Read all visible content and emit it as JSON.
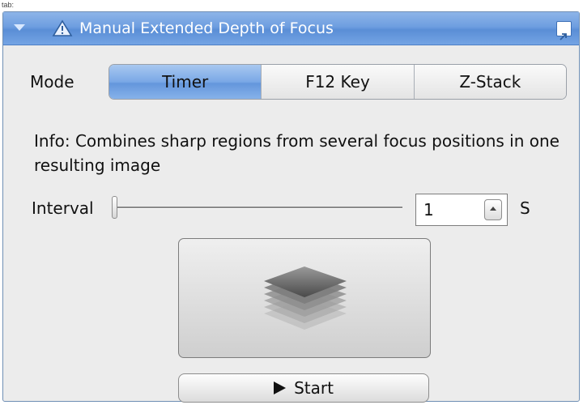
{
  "tab": {
    "label": "tab:"
  },
  "panel": {
    "title": "Manual Extended Depth of Focus",
    "icons": {
      "collapse": "chevron-down-icon",
      "warning": "warning-triangle-icon",
      "undock": "undock-icon"
    }
  },
  "mode": {
    "label": "Mode",
    "options": [
      "Timer",
      "F12 Key",
      "Z-Stack"
    ],
    "selected": "Timer"
  },
  "info": {
    "text": "Info: Combines sharp regions from several focus positions in one resulting image"
  },
  "interval": {
    "label": "Interval",
    "slider_value": 1,
    "value": "1",
    "unit": "S"
  },
  "preview": {
    "icon": "z-stack-layers-icon"
  },
  "start": {
    "label": "Start",
    "icon": "play-icon"
  },
  "colors": {
    "title_bar": "#6e9ee0",
    "active_segment": "#7aa8e6",
    "panel_bg": "#ececec"
  }
}
